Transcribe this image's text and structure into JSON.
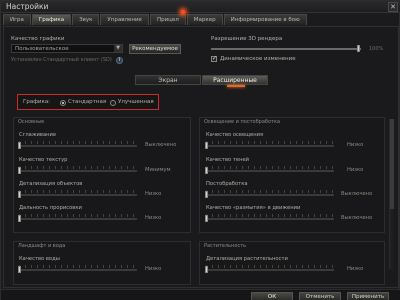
{
  "window": {
    "title": "Настройки",
    "close_glyph": "✕"
  },
  "tabs": [
    {
      "label": "Игра",
      "active": false
    },
    {
      "label": "Графика",
      "active": true
    },
    {
      "label": "Звук",
      "active": false
    },
    {
      "label": "Управление",
      "active": false
    },
    {
      "label": "Прицел",
      "active": false
    },
    {
      "label": "Маркер",
      "active": false
    },
    {
      "label": "Информирование в бою",
      "active": false
    }
  ],
  "quality": {
    "label": "Качество графики",
    "selected": "Пользовательское",
    "recommend_button": "Рекомендуемое",
    "preset_note": "Установлен Стандартный клиент (SD)",
    "info_glyph": "i"
  },
  "resolution": {
    "label": "Разрешение 3D рендера",
    "value": "100%",
    "percent": 100,
    "dynamic_label": "Динамическое изменение",
    "dynamic_checked": true
  },
  "subtabs": [
    {
      "label": "Экран",
      "active": false
    },
    {
      "label": "Расширенные",
      "active": true
    }
  ],
  "graphics_mode": {
    "label": "Графика:",
    "options": [
      {
        "label": "Стандартная",
        "selected": true
      },
      {
        "label": "Улучшенная",
        "selected": false
      }
    ]
  },
  "groups": {
    "main": {
      "title": "Основные",
      "rows": [
        {
          "label": "Сглаживание",
          "value": "Выключено",
          "level": 0
        },
        {
          "label": "Качество текстур",
          "value": "Минимум",
          "level": 0
        },
        {
          "label": "Детализация объектов",
          "value": "Низко",
          "level": 0
        },
        {
          "label": "Дальность прорисовки",
          "value": "Низко",
          "level": 0
        }
      ]
    },
    "lighting": {
      "title": "Освещение и постобработка",
      "rows": [
        {
          "label": "Качество освещения",
          "value": "Низко",
          "level": 0
        },
        {
          "label": "Качество теней",
          "value": "Низко",
          "level": 0
        },
        {
          "label": "Постобработка",
          "value": "Выключено",
          "level": 0
        },
        {
          "label": "Качество «размытия» в движении",
          "value": "Выключено",
          "level": 0
        }
      ]
    },
    "landscape": {
      "title": "Ландшафт и вода",
      "rows": [
        {
          "label": "Качество воды",
          "value": "Низко",
          "level": 0
        }
      ]
    },
    "vegetation": {
      "title": "Растительность",
      "rows": [
        {
          "label": "Детализация растительности",
          "value": "Низко",
          "level": 0
        }
      ]
    }
  },
  "footer": {
    "ok": "ОК",
    "cancel": "Отменить",
    "apply": "Применить"
  }
}
